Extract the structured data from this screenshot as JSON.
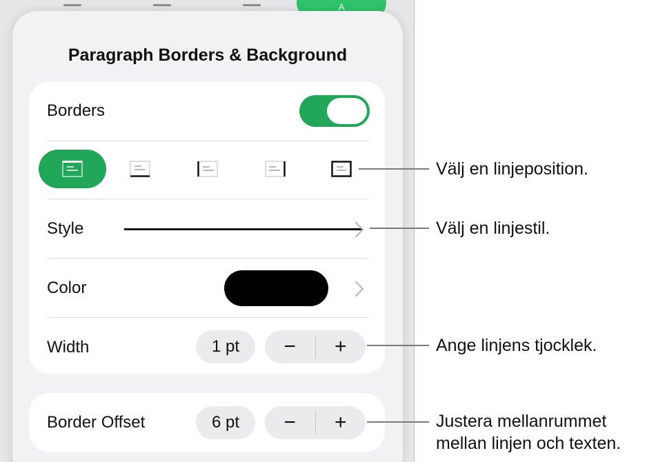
{
  "popover": {
    "title": "Paragraph Borders & Background",
    "borders": {
      "label": "Borders",
      "enabled": true
    },
    "positions": [
      {
        "name": "top",
        "selected": true
      },
      {
        "name": "bottom",
        "selected": false
      },
      {
        "name": "left",
        "selected": false
      },
      {
        "name": "right",
        "selected": false
      },
      {
        "name": "box",
        "selected": false
      }
    ],
    "style": {
      "label": "Style"
    },
    "color": {
      "label": "Color",
      "value_hex": "#000000"
    },
    "width": {
      "label": "Width",
      "value": "1 pt",
      "decrement": "−",
      "increment": "+"
    },
    "offset": {
      "label": "Border Offset",
      "value": "6 pt",
      "decrement": "−",
      "increment": "+"
    }
  },
  "callouts": {
    "position": "Välj en linjeposition.",
    "style": "Välj en linjestil.",
    "width": "Ange linjens tjocklek.",
    "offset_line1": "Justera mellanrummet",
    "offset_line2": "mellan linjen och texten."
  },
  "colors": {
    "accent": "#21a65a",
    "panel": "#f2f2f5",
    "card": "#ffffff",
    "control": "#ebebee"
  }
}
